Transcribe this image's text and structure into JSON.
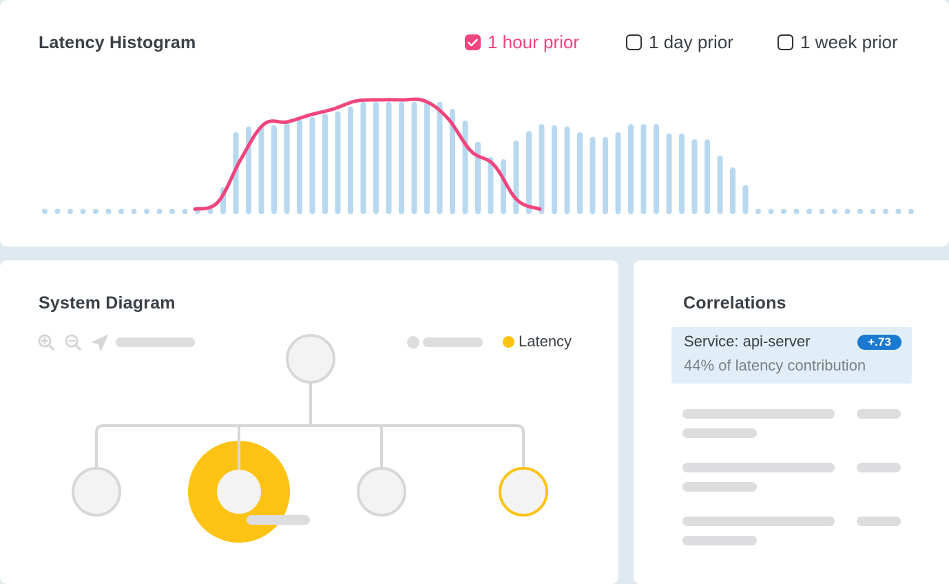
{
  "histogram": {
    "title": "Latency Histogram",
    "range_options": [
      {
        "label": "1 hour prior",
        "checked": true
      },
      {
        "label": "1 day prior",
        "checked": false
      },
      {
        "label": "1 week prior",
        "checked": false
      }
    ],
    "bar_color": "#b8d8f0",
    "line_color": "#f0457d",
    "bar_values": [
      0,
      0,
      0,
      0,
      0,
      0,
      0,
      0,
      0,
      0,
      0,
      0,
      0.02,
      0.05,
      0.23,
      0.7,
      0.75,
      0.75,
      0.76,
      0.79,
      0.81,
      0.83,
      0.86,
      0.88,
      0.92,
      0.96,
      0.96,
      0.96,
      0.96,
      0.96,
      0.96,
      0.96,
      0.9,
      0.8,
      0.62,
      0.49,
      0.47,
      0.63,
      0.71,
      0.77,
      0.76,
      0.75,
      0.7,
      0.66,
      0.66,
      0.7,
      0.77,
      0.77,
      0.77,
      0.69,
      0.69,
      0.64,
      0.64,
      0.5,
      0.4,
      0.25,
      0,
      0,
      0,
      0,
      0,
      0,
      0,
      0,
      0,
      0,
      0,
      0,
      0
    ],
    "hour_prior_line": [
      0.02,
      0.08,
      0.45,
      0.75,
      0.77,
      0.83,
      0.88,
      0.95,
      0.96,
      0.96,
      0.95,
      0.8,
      0.52,
      0.4,
      0.1,
      0.02
    ]
  },
  "diagram": {
    "title": "System Diagram",
    "icons": [
      "zoom-in-icon",
      "zoom-out-icon",
      "navigate-icon"
    ],
    "legend_latency_label": "Latency",
    "highlight_color": "#fcc314"
  },
  "correlations": {
    "title": "Correlations",
    "service_label": "Service: api-server",
    "badge": "+.73",
    "contribution": "44% of latency contribution",
    "badge_color": "#1a7ad0"
  }
}
